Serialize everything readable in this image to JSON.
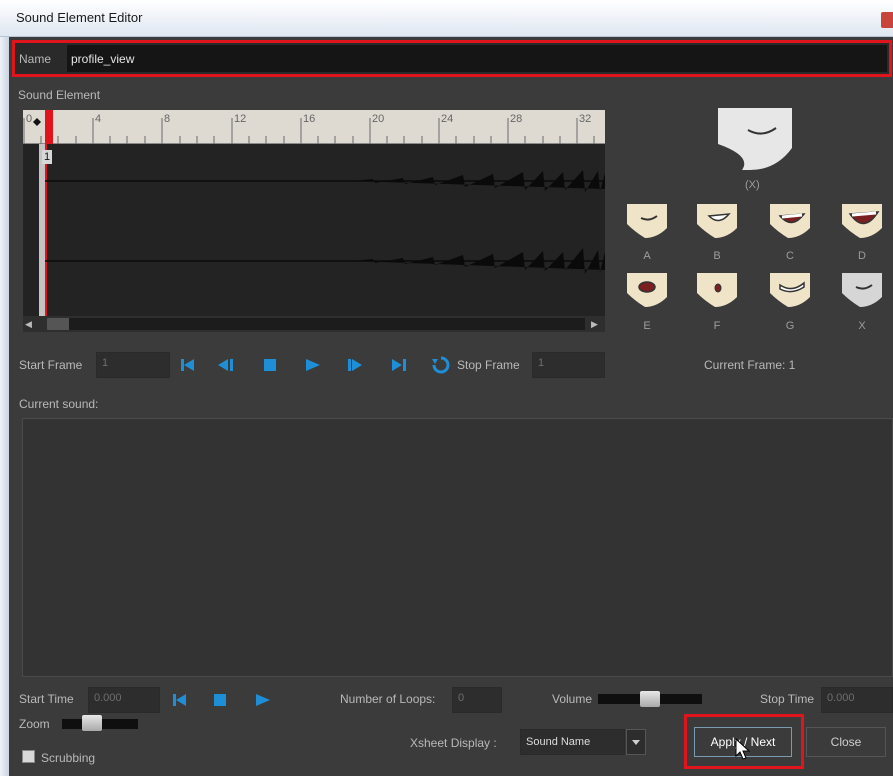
{
  "window": {
    "title": "Sound Element Editor"
  },
  "name_row": {
    "label": "Name",
    "value": "profile_view"
  },
  "sound_element": {
    "section_label": "Sound Element",
    "ruler_labels": [
      "0",
      "4",
      "8",
      "12",
      "16",
      "20",
      "24",
      "28",
      "32"
    ],
    "frame_marker": "1"
  },
  "mouth_panel": {
    "current_label": "(X)",
    "row1_labels": [
      "A",
      "B",
      "C",
      "D"
    ],
    "row2_labels": [
      "E",
      "F",
      "G",
      "X"
    ]
  },
  "playback": {
    "start_frame_label": "Start Frame",
    "start_frame_value": "1",
    "stop_frame_label": "Stop Frame",
    "stop_frame_value": "1",
    "current_frame": "Current Frame: 1"
  },
  "current_sound": {
    "label": "Current sound:"
  },
  "sound_controls": {
    "start_time_label": "Start Time",
    "start_time_value": "0.000",
    "loops_label": "Number of Loops:",
    "loops_value": "0",
    "volume_label": "Volume",
    "stop_time_label": "Stop Time",
    "stop_time_value": "0.000"
  },
  "bottom": {
    "zoom_label": "Zoom",
    "scrubbing_label": "Scrubbing",
    "xsheet_label": "Xsheet Display :",
    "xsheet_value": "Sound Name",
    "apply_next_label": "Apply / Next",
    "close_label": "Close"
  },
  "colors": {
    "highlight": "#e0141c",
    "accent_blue": "#1e8fd6",
    "panel": "#3b3b3b"
  }
}
